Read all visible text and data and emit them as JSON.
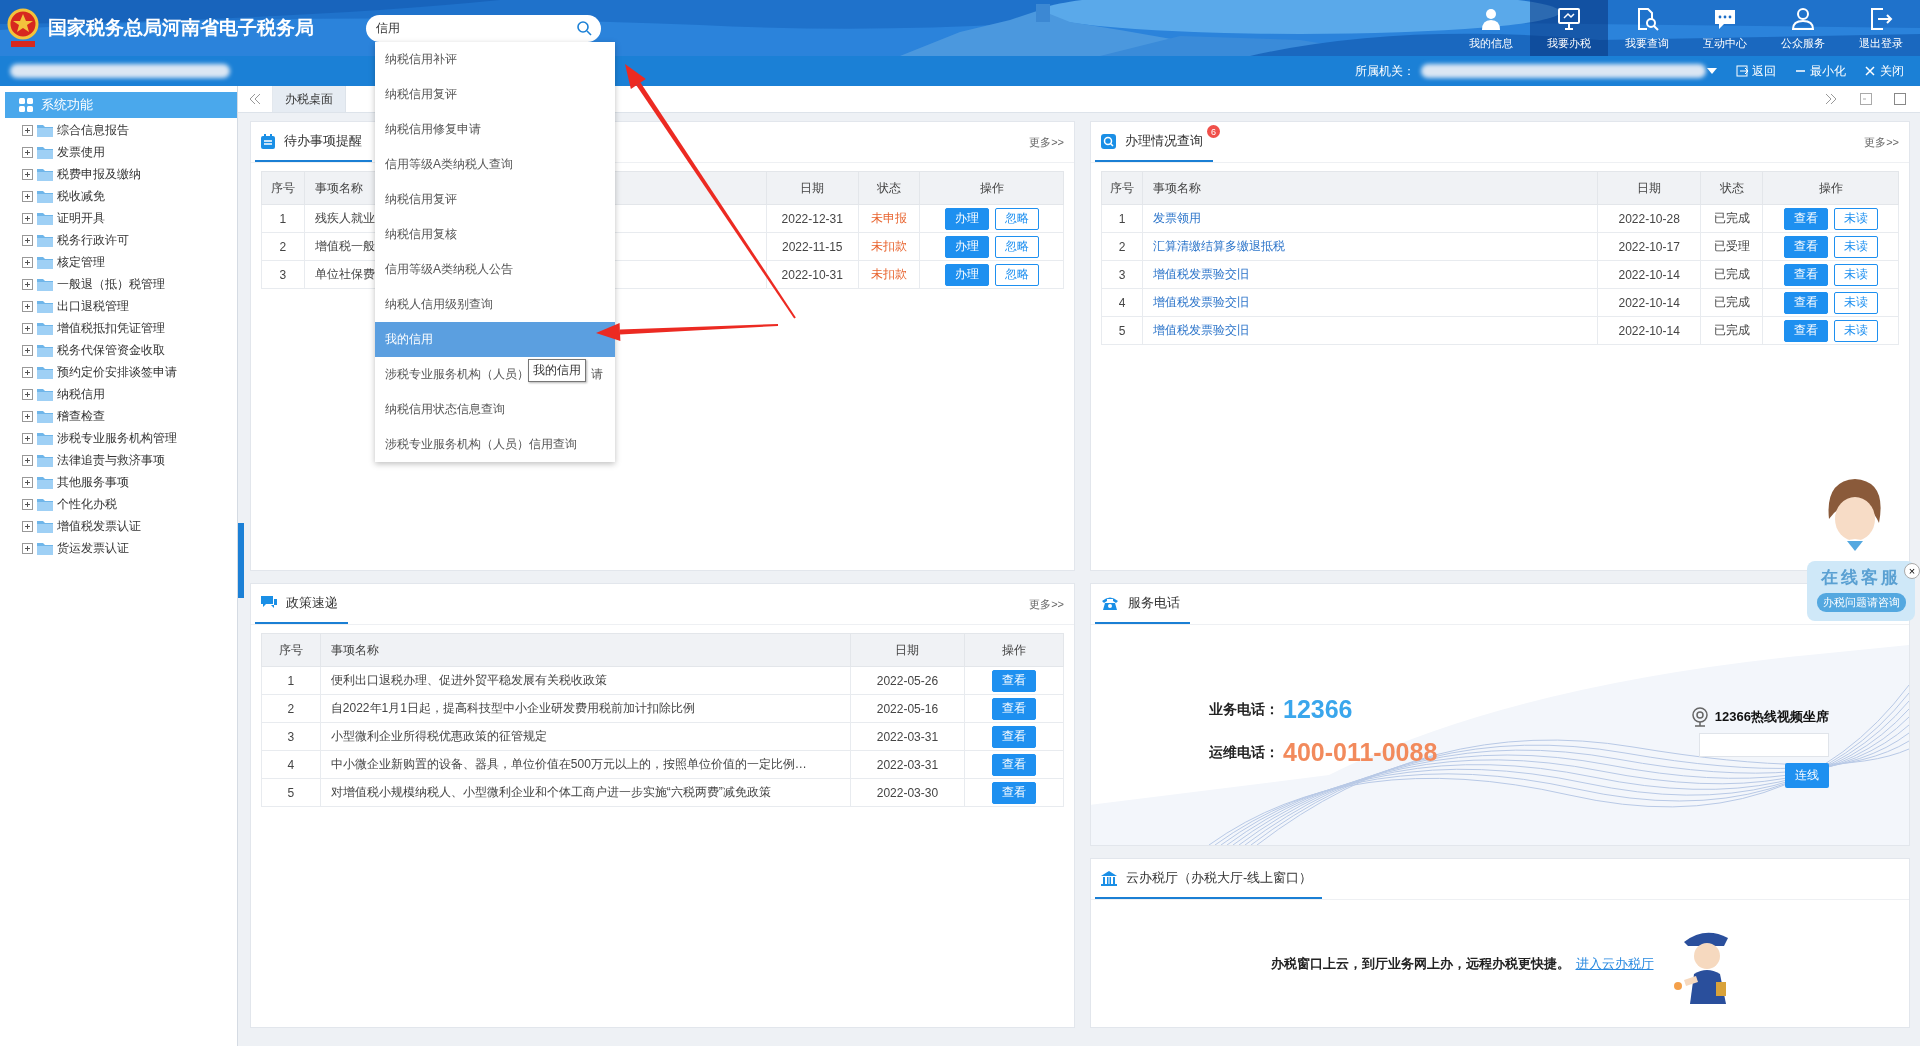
{
  "header": {
    "title": "国家税务总局河南省电子税务局",
    "search": {
      "value": "信用"
    },
    "nav": [
      {
        "label": "我的信息",
        "selected": false
      },
      {
        "label": "我要办税",
        "selected": true
      },
      {
        "label": "我要查询",
        "selected": false
      },
      {
        "label": "互动中心",
        "selected": false
      },
      {
        "label": "公众服务",
        "selected": false
      },
      {
        "label": "退出登录",
        "selected": false
      }
    ]
  },
  "subbar": {
    "org_label": "所属机关：",
    "actions": [
      {
        "label": "返回"
      },
      {
        "label": "最小化"
      },
      {
        "label": "关闭"
      }
    ]
  },
  "sidebar": {
    "title": "系统功能",
    "items": [
      {
        "label": "综合信息报告",
        "expanded": false
      },
      {
        "label": "发票使用",
        "expanded": false
      },
      {
        "label": "税费申报及缴纳",
        "expanded": false
      },
      {
        "label": "税收减免",
        "expanded": false
      },
      {
        "label": "证明开具",
        "expanded": false
      },
      {
        "label": "税务行政许可",
        "expanded": false
      },
      {
        "label": "核定管理",
        "expanded": false
      },
      {
        "label": "一般退（抵）税管理",
        "expanded": false
      },
      {
        "label": "出口退税管理",
        "expanded": false
      },
      {
        "label": "增值税抵扣凭证管理",
        "expanded": false
      },
      {
        "label": "税务代保管资金收取",
        "expanded": false
      },
      {
        "label": "预约定价安排谈签申请",
        "expanded": false
      },
      {
        "label": "纳税信用",
        "expanded": false
      },
      {
        "label": "稽查检查",
        "expanded": false
      },
      {
        "label": "涉税专业服务机构管理",
        "expanded": false
      },
      {
        "label": "法律追责与救济事项",
        "expanded": false
      },
      {
        "label": "其他服务事项",
        "expanded": false
      },
      {
        "label": "个性化办税",
        "expanded": false
      },
      {
        "label": "增值税发票认证",
        "expanded": false
      },
      {
        "label": "货运发票认证",
        "expanded": false
      }
    ]
  },
  "tabs": [
    {
      "label": "办税桌面",
      "selected": true
    }
  ],
  "search_dropdown": {
    "items": [
      {
        "label": "纳税信用补评",
        "selected": false
      },
      {
        "label": "纳税信用复评",
        "selected": false
      },
      {
        "label": "纳税信用修复申请",
        "selected": false
      },
      {
        "label": "信用等级A类纳税人查询",
        "selected": false
      },
      {
        "label": "纳税信用复评",
        "selected": false
      },
      {
        "label": "纳税信用复核",
        "selected": false
      },
      {
        "label": "信用等级A类纳税人公告",
        "selected": false
      },
      {
        "label": "纳税人信用级别查询",
        "selected": false
      },
      {
        "label": "我的信用",
        "selected": true
      },
      {
        "label": "涉税专业服务机构（人员）",
        "tooltip": "我的信用",
        "tail": "请",
        "selected": false
      },
      {
        "label": "纳税信用状态信息查询",
        "selected": false
      },
      {
        "label": "涉税专业服务机构（人员）信用查询",
        "selected": false
      }
    ]
  },
  "todo_panel": {
    "title": "待办事项提醒",
    "more": "更多>>",
    "columns": [
      "序号",
      "事项名称",
      "日期",
      "状态",
      "操作"
    ],
    "rows": [
      {
        "no": "1",
        "name": "残疾人就业",
        "date": "2022-12-31",
        "status": {
          "text": "未申报",
          "color": "#e8642f"
        },
        "actions": [
          {
            "label": "办理",
            "kind": "solid"
          },
          {
            "label": "忽略",
            "kind": "outline"
          }
        ]
      },
      {
        "no": "2",
        "name": "增值税一般",
        "date": "2022-11-15",
        "status": {
          "text": "未扣款",
          "color": "#e8642f"
        },
        "actions": [
          {
            "label": "办理",
            "kind": "solid"
          },
          {
            "label": "忽略",
            "kind": "outline"
          }
        ]
      },
      {
        "no": "3",
        "name": "单位社保费",
        "date": "2022-10-31",
        "status": {
          "text": "未扣款",
          "color": "#e8642f"
        },
        "actions": [
          {
            "label": "办理",
            "kind": "solid"
          },
          {
            "label": "忽略",
            "kind": "outline"
          }
        ]
      }
    ]
  },
  "progress_panel": {
    "title": "办理情况查询",
    "badge": "6",
    "more": "更多>>",
    "name_links": true,
    "columns": [
      "序号",
      "事项名称",
      "日期",
      "状态",
      "操作"
    ],
    "rows": [
      {
        "no": "1",
        "name": "发票领用",
        "date": "2022-10-28",
        "status": {
          "text": "已完成"
        },
        "actions": [
          {
            "label": "查看",
            "kind": "solid"
          },
          {
            "label": "未读",
            "kind": "outline"
          }
        ]
      },
      {
        "no": "2",
        "name": "汇算清缴结算多缴退抵税",
        "date": "2022-10-17",
        "status": {
          "text": "已受理"
        },
        "actions": [
          {
            "label": "查看",
            "kind": "solid"
          },
          {
            "label": "未读",
            "kind": "outline"
          }
        ]
      },
      {
        "no": "3",
        "name": "增值税发票验交旧",
        "date": "2022-10-14",
        "status": {
          "text": "已完成"
        },
        "actions": [
          {
            "label": "查看",
            "kind": "solid"
          },
          {
            "label": "未读",
            "kind": "outline"
          }
        ]
      },
      {
        "no": "4",
        "name": "增值税发票验交旧",
        "date": "2022-10-14",
        "status": {
          "text": "已完成"
        },
        "actions": [
          {
            "label": "查看",
            "kind": "solid"
          },
          {
            "label": "未读",
            "kind": "outline"
          }
        ]
      },
      {
        "no": "5",
        "name": "增值税发票验交旧",
        "date": "2022-10-14",
        "status": {
          "text": "已完成"
        },
        "actions": [
          {
            "label": "查看",
            "kind": "solid"
          },
          {
            "label": "未读",
            "kind": "outline"
          }
        ]
      }
    ]
  },
  "policy_panel": {
    "title": "政策速递",
    "more": "更多>>",
    "columns": [
      "序号",
      "事项名称",
      "日期",
      "操作"
    ],
    "rows": [
      {
        "no": "1",
        "name": "便利出口退税办理、促进外贸平稳发展有关税收政策",
        "date": "2022-05-26",
        "actions": [
          {
            "label": "查看",
            "kind": "solid"
          }
        ]
      },
      {
        "no": "2",
        "name": "自2022年1月1日起，提高科技型中小企业研发费用税前加计扣除比例",
        "date": "2022-05-16",
        "actions": [
          {
            "label": "查看",
            "kind": "solid"
          }
        ]
      },
      {
        "no": "3",
        "name": "小型微利企业所得税优惠政策的征管规定",
        "date": "2022-03-31",
        "actions": [
          {
            "label": "查看",
            "kind": "solid"
          }
        ]
      },
      {
        "no": "4",
        "name": "中小微企业新购置的设备、器具，单位价值在500万元以上的，按照单位价值的一定比例…",
        "date": "2022-03-31",
        "actions": [
          {
            "label": "查看",
            "kind": "solid"
          }
        ]
      },
      {
        "no": "5",
        "name": "对增值税小规模纳税人、小型微利企业和个体工商户进一步实施“六税两费”减免政策",
        "date": "2022-03-30",
        "actions": [
          {
            "label": "查看",
            "kind": "solid"
          }
        ]
      }
    ]
  },
  "phone_panel": {
    "title": "服务电话",
    "lines": [
      {
        "label": "业务电话：",
        "number": "12366",
        "color": "#3aa6ec"
      },
      {
        "label": "运维电话：",
        "number": "400-011-0088",
        "color": "#f28a5c"
      }
    ],
    "video": {
      "label": "12366热线视频坐席",
      "button": "连线"
    }
  },
  "cloud_panel": {
    "title": "云办税厅（办税大厅-线上窗口）",
    "text": "办税窗口上云，到厅业务网上办，远程办税更快捷。",
    "link": "进入云办税厅"
  },
  "chat_widget": {
    "title": "在线客服",
    "subtitle": "办税问题请咨询",
    "close": "×"
  },
  "annotations": [
    {
      "kind": "arrow"
    },
    {
      "kind": "arrow"
    }
  ]
}
